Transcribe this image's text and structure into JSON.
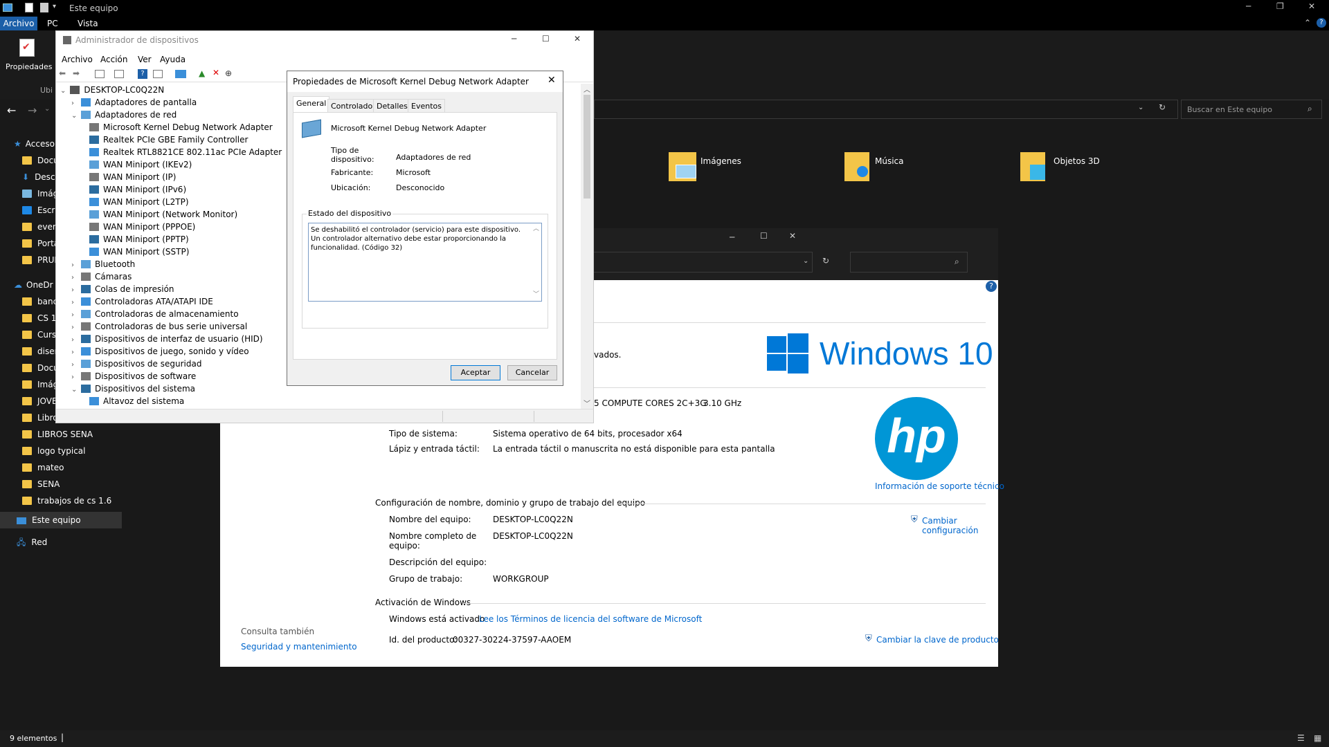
{
  "explorer": {
    "title": "Este equipo",
    "tabs": [
      "Archivo",
      "PC",
      "Vista"
    ],
    "ribbon_button": "Propiedades",
    "ribbon_group_partial": "Ubi",
    "search_placeholder": "Buscar en Este equipo",
    "folders": [
      {
        "label": "Imágenes"
      },
      {
        "label": "Música"
      },
      {
        "label": "Objetos 3D"
      }
    ],
    "nav": {
      "quick_access": "Acceso",
      "items": [
        "Docu",
        "Desc",
        "Imág",
        "Escri",
        "even",
        "Porta",
        "PRUE"
      ],
      "onedrive": "OneDr",
      "onedrive_items": [
        "banc",
        "CS 1.",
        "Curs",
        "diser",
        "Docu",
        "Imág",
        "JOVE",
        "Libro",
        "LIBROS SENA",
        "logo typical",
        "mateo",
        "SENA",
        "trabajos de cs 1.6"
      ],
      "this_pc": "Este equipo",
      "network": "Red"
    },
    "status": "9 elementos"
  },
  "device_manager": {
    "title": "Administrador de dispositivos",
    "menu": [
      "Archivo",
      "Acción",
      "Ver",
      "Ayuda"
    ],
    "root": "DESKTOP-LC0Q22N",
    "tree": [
      {
        "label": "Adaptadores de pantalla",
        "level": 1,
        "state": "collapsed"
      },
      {
        "label": "Adaptadores de red",
        "level": 1,
        "state": "expanded"
      },
      {
        "label": "Microsoft Kernel Debug Network Adapter",
        "level": 2,
        "state": "disabled"
      },
      {
        "label": "Realtek PCIe GBE Family Controller",
        "level": 2,
        "state": ""
      },
      {
        "label": "Realtek RTL8821CE 802.11ac PCIe Adapter",
        "level": 2,
        "state": ""
      },
      {
        "label": "WAN Miniport (IKEv2)",
        "level": 2,
        "state": ""
      },
      {
        "label": "WAN Miniport (IP)",
        "level": 2,
        "state": ""
      },
      {
        "label": "WAN Miniport (IPv6)",
        "level": 2,
        "state": ""
      },
      {
        "label": "WAN Miniport (L2TP)",
        "level": 2,
        "state": ""
      },
      {
        "label": "WAN Miniport (Network Monitor)",
        "level": 2,
        "state": ""
      },
      {
        "label": "WAN Miniport (PPPOE)",
        "level": 2,
        "state": ""
      },
      {
        "label": "WAN Miniport (PPTP)",
        "level": 2,
        "state": ""
      },
      {
        "label": "WAN Miniport (SSTP)",
        "level": 2,
        "state": ""
      },
      {
        "label": "Bluetooth",
        "level": 1,
        "state": "collapsed"
      },
      {
        "label": "Cámaras",
        "level": 1,
        "state": "collapsed"
      },
      {
        "label": "Colas de impresión",
        "level": 1,
        "state": "collapsed"
      },
      {
        "label": "Controladoras ATA/ATAPI IDE",
        "level": 1,
        "state": "collapsed"
      },
      {
        "label": "Controladoras de almacenamiento",
        "level": 1,
        "state": "collapsed"
      },
      {
        "label": "Controladoras de bus serie universal",
        "level": 1,
        "state": "collapsed"
      },
      {
        "label": "Dispositivos de interfaz de usuario (HID)",
        "level": 1,
        "state": "collapsed"
      },
      {
        "label": "Dispositivos de juego, sonido y vídeo",
        "level": 1,
        "state": "collapsed"
      },
      {
        "label": "Dispositivos de seguridad",
        "level": 1,
        "state": "collapsed"
      },
      {
        "label": "Dispositivos de software",
        "level": 1,
        "state": "collapsed"
      },
      {
        "label": "Dispositivos del sistema",
        "level": 1,
        "state": "expanded"
      },
      {
        "label": "Altavoz del sistema",
        "level": 2,
        "state": ""
      }
    ]
  },
  "properties_dialog": {
    "title": "Propiedades de Microsoft Kernel Debug Network Adapter",
    "tabs": [
      "General",
      "Controlador",
      "Detalles",
      "Eventos"
    ],
    "device_name": "Microsoft Kernel Debug Network Adapter",
    "fields": {
      "type_label_1": "Tipo de",
      "type_label_2": "dispositivo:",
      "type_value": "Adaptadores de red",
      "maker_label": "Fabricante:",
      "maker_value": "Microsoft",
      "location_label": "Ubicación:",
      "location_value": "Desconocido"
    },
    "status_group": "Estado del dispositivo",
    "status_text": "Se deshabilitó el controlador (servicio) para este dispositivo. Un controlador alternativo debe estar proporcionando la funcionalidad. (Código 32)",
    "ok": "Aceptar",
    "cancel": "Cancelar"
  },
  "system": {
    "partial_text": "vados.",
    "windows_brand": "Windows 10",
    "processor_partial": "5 COMPUTE CORES 2C+3G",
    "processor_speed": "3.10 GHz",
    "system_type_label": "Tipo de sistema:",
    "system_type_value": "Sistema operativo de 64 bits, procesador x64",
    "pen_label": "Lápiz y entrada táctil:",
    "pen_value": "La entrada táctil o manuscrita no está disponible para esta pantalla",
    "support_link": "Información de soporte técnico",
    "naming_section": "Configuración de nombre, dominio y grupo de trabajo del equipo",
    "computer_name_label": "Nombre del equipo:",
    "computer_name_value": "DESKTOP-LC0Q22N",
    "full_name_label_1": "Nombre completo de",
    "full_name_label_2": "equipo:",
    "full_name_value": "DESKTOP-LC0Q22N",
    "desc_label": "Descripción del equipo:",
    "workgroup_label": "Grupo de trabajo:",
    "workgroup_value": "WORKGROUP",
    "change_settings_1": "Cambiar",
    "change_settings_2": "configuración",
    "activation_section": "Activación de Windows",
    "activated_label": "Windows está activado",
    "license_link": "Lee los Términos de licencia del software de Microsoft",
    "product_id_label": "Id. del producto:",
    "product_id_value": "00327-30224-37597-AAOEM",
    "change_key": "Cambiar la clave de producto",
    "see_also": "Consulta también",
    "security_link": "Seguridad y mantenimiento",
    "hp_logo": "hp"
  }
}
